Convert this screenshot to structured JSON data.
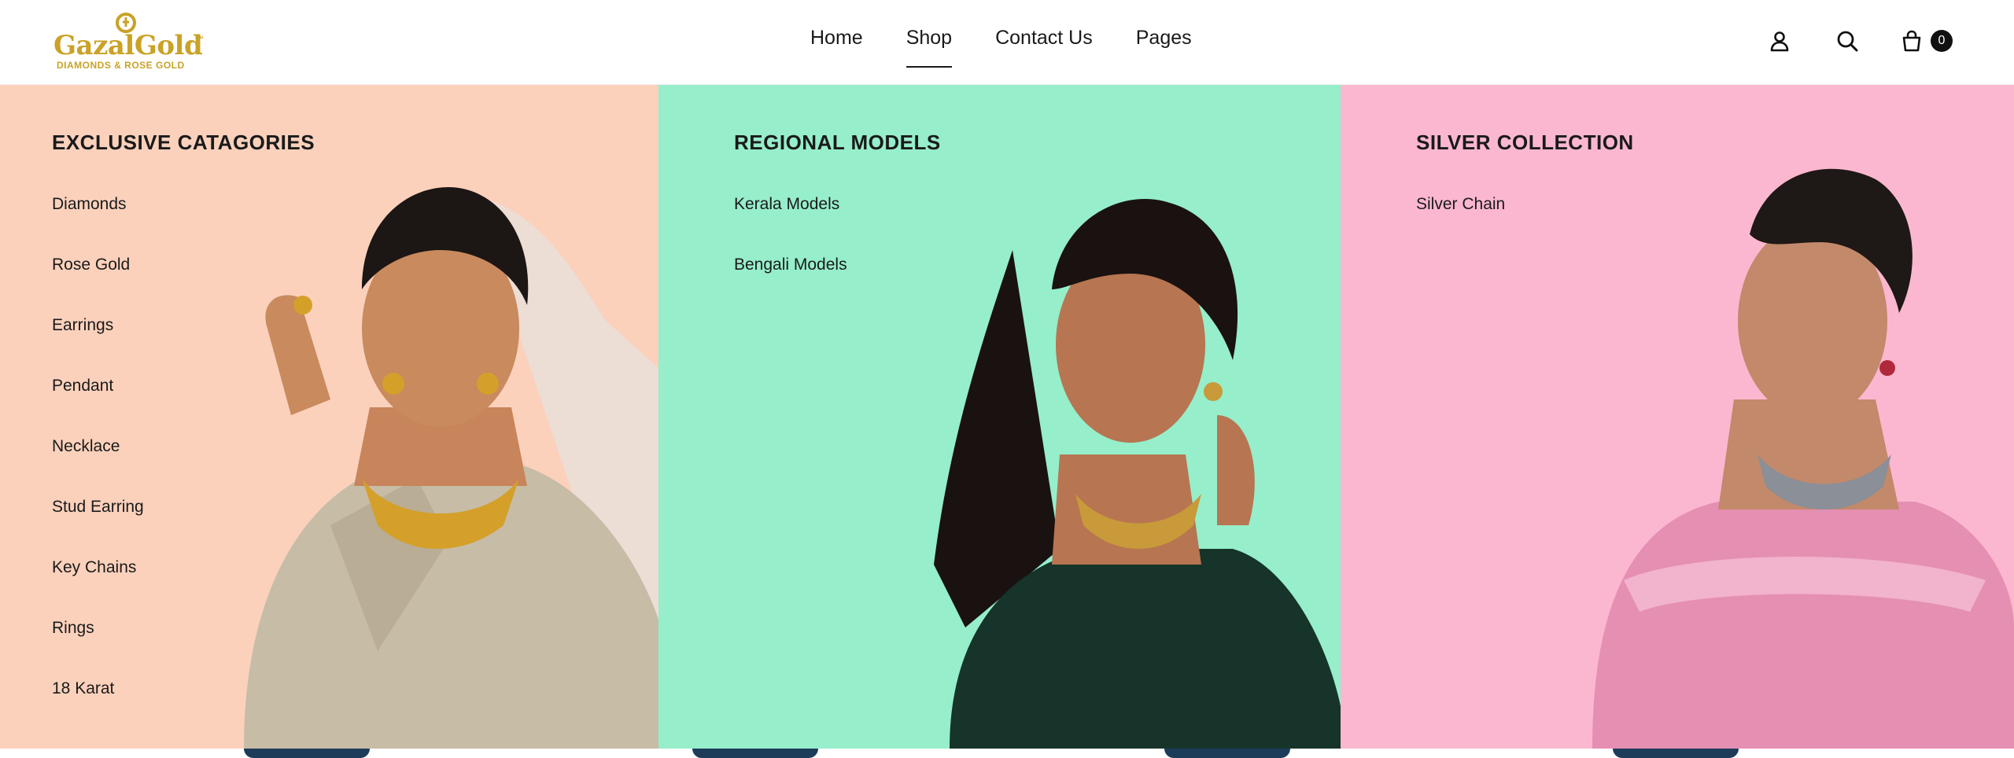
{
  "header": {
    "logo": {
      "brand": "GazalGold",
      "trademark": "™",
      "tagline": "DIAMONDS & ROSE GOLD",
      "color": "#c9a227"
    },
    "nav": [
      {
        "label": "Home",
        "active": false
      },
      {
        "label": "Shop",
        "active": true
      },
      {
        "label": "Contact Us",
        "active": false
      },
      {
        "label": "Pages",
        "active": false
      }
    ],
    "icons": {
      "account": "user-icon",
      "search": "search-icon",
      "cart": "shopping-bag-icon"
    },
    "cart_count": "0"
  },
  "mega_menu": {
    "columns": [
      {
        "title": "EXCLUSIVE CATAGORIES",
        "background": "#fbd1bc",
        "links": [
          "Diamonds",
          "Rose Gold",
          "Earrings",
          "Pendant",
          "Necklace",
          "Stud Earring",
          "Key Chains",
          "Rings",
          "18 Karat"
        ]
      },
      {
        "title": "REGIONAL MODELS",
        "background": "#96eecb",
        "links": [
          "Kerala Models",
          "Bengali Models"
        ]
      },
      {
        "title": "SILVER COLLECTION",
        "background": "#fbb7d0",
        "links": [
          "Silver Chain"
        ]
      }
    ]
  }
}
